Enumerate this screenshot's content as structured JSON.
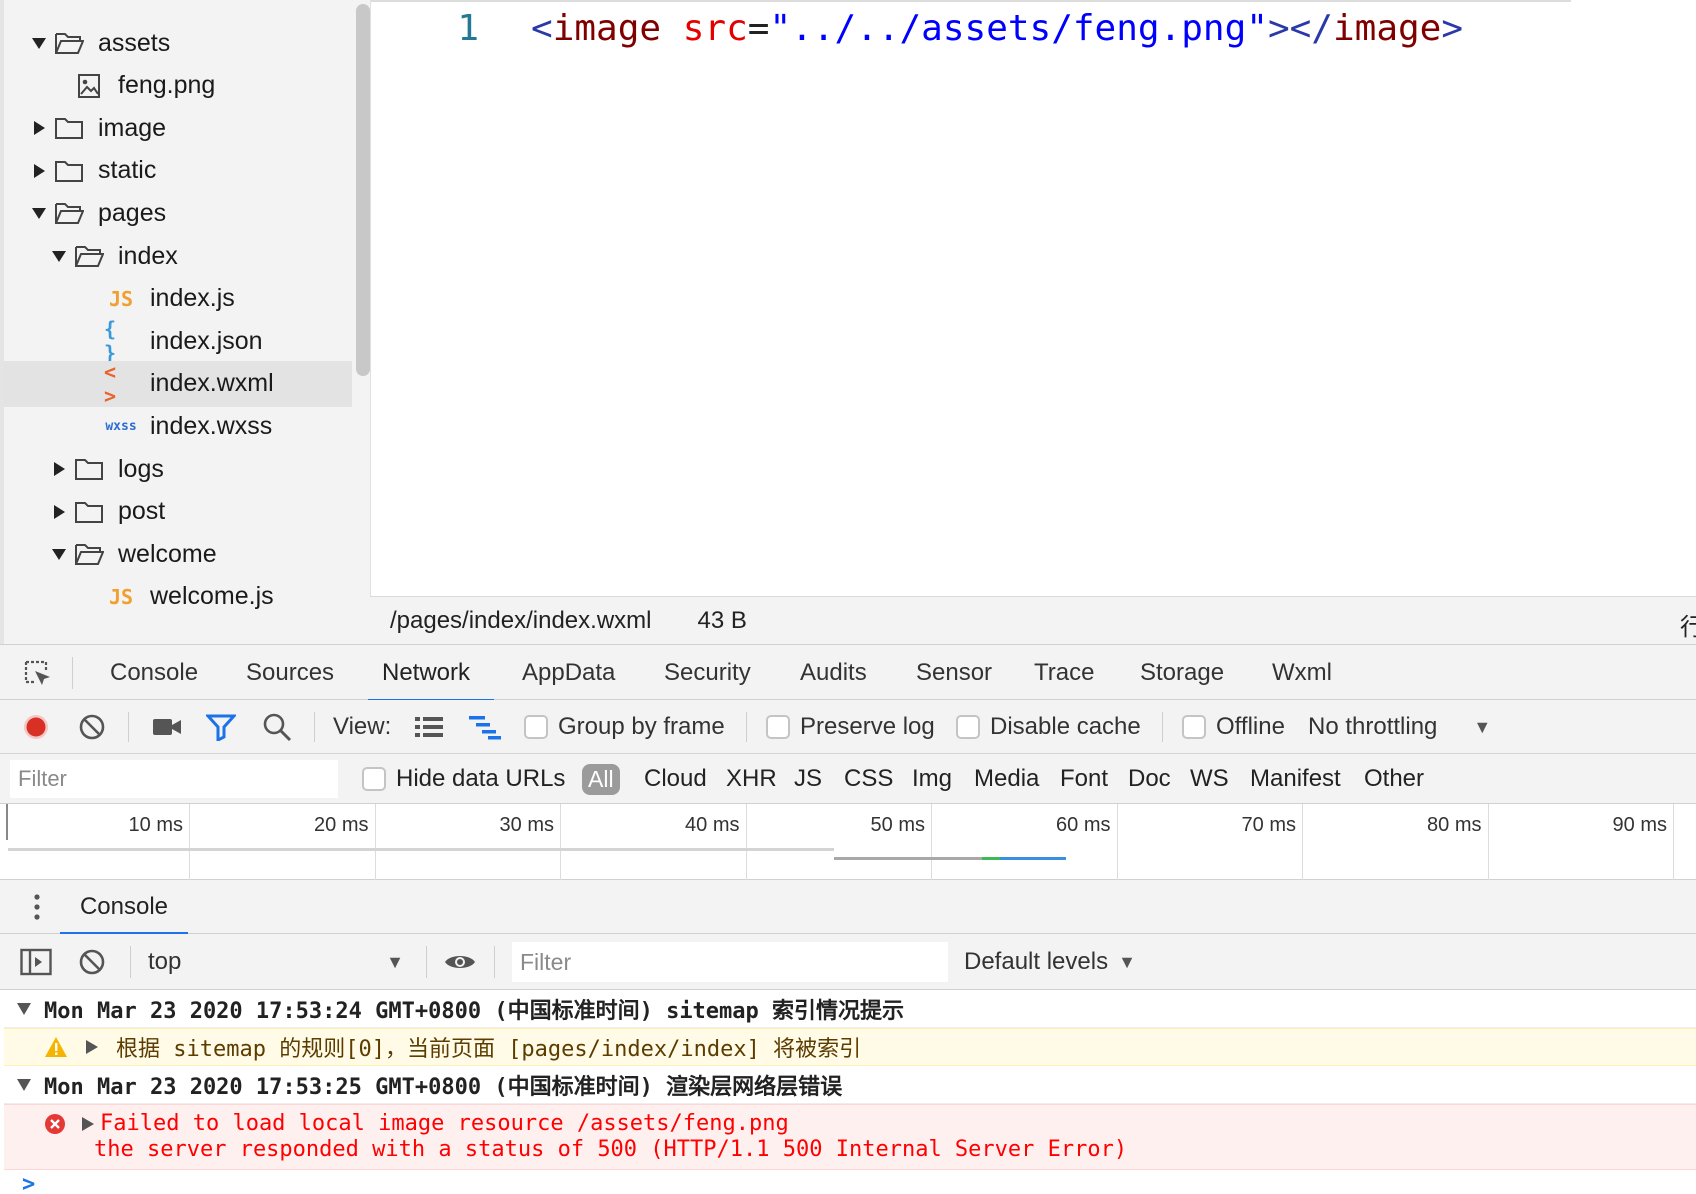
{
  "file_tree": {
    "items": [
      {
        "label": "assets",
        "type": "folder",
        "expanded": true,
        "depth": 0
      },
      {
        "label": "feng.png",
        "type": "image",
        "depth": 1
      },
      {
        "label": "image",
        "type": "folder",
        "expanded": false,
        "depth": 0
      },
      {
        "label": "static",
        "type": "folder",
        "expanded": false,
        "depth": 0
      },
      {
        "label": "pages",
        "type": "folder",
        "expanded": true,
        "depth": 0
      },
      {
        "label": "index",
        "type": "folder",
        "expanded": true,
        "depth": 1
      },
      {
        "label": "index.js",
        "type": "js",
        "icon_text": "JS",
        "depth": 2
      },
      {
        "label": "index.json",
        "type": "json",
        "icon_text": "{ }",
        "depth": 2
      },
      {
        "label": "index.wxml",
        "type": "wxml",
        "icon_text": "< >",
        "depth": 2,
        "selected": true
      },
      {
        "label": "index.wxss",
        "type": "wxss",
        "icon_text": "wxss",
        "depth": 2
      },
      {
        "label": "logs",
        "type": "folder",
        "expanded": false,
        "depth": 1
      },
      {
        "label": "post",
        "type": "folder",
        "expanded": false,
        "depth": 1
      },
      {
        "label": "welcome",
        "type": "folder",
        "expanded": true,
        "depth": 1
      },
      {
        "label": "welcome.js",
        "type": "js",
        "icon_text": "JS",
        "depth": 2
      }
    ]
  },
  "editor": {
    "line_number": "1",
    "code": {
      "open_bracket": "<",
      "tag": "image",
      "attr": " src",
      "eq": "=",
      "value": "\"../../assets/feng.png\"",
      "close_open": "></",
      "close_tag": "image",
      "close_bracket": ">"
    }
  },
  "status_bar": {
    "path": "/pages/index/index.wxml",
    "size": "43 B",
    "edge_text": "行"
  },
  "devtools": {
    "tabs": [
      "Console",
      "Sources",
      "Network",
      "AppData",
      "Security",
      "Audits",
      "Sensor",
      "Trace",
      "Storage",
      "Wxml"
    ],
    "active_tab": "Network"
  },
  "network_toolbar": {
    "view_label": "View:",
    "group_by_frame": "Group by frame",
    "preserve_log": "Preserve log",
    "disable_cache": "Disable cache",
    "offline": "Offline",
    "throttling": "No throttling"
  },
  "network_filter": {
    "placeholder": "Filter",
    "hide_data_urls": "Hide data URLs",
    "types": [
      "All",
      "Cloud",
      "XHR",
      "JS",
      "CSS",
      "Img",
      "Media",
      "Font",
      "Doc",
      "WS",
      "Manifest",
      "Other"
    ],
    "active_type": "All"
  },
  "timeline": {
    "ticks": [
      "10 ms",
      "20 ms",
      "30 ms",
      "40 ms",
      "50 ms",
      "60 ms",
      "70 ms",
      "80 ms",
      "90 ms"
    ]
  },
  "console_drawer": {
    "tab": "Console",
    "context": "top",
    "filter_placeholder": "Filter",
    "levels": "Default levels"
  },
  "console_messages": {
    "group1": "Mon Mar 23 2020 17:53:24 GMT+0800 (中国标准时间) sitemap 索引情况提示",
    "warn": "根据 sitemap 的规则[0]，当前页面 [pages/index/index] 将被索引",
    "group2": "Mon Mar 23 2020 17:53:25 GMT+0800 (中国标准时间) 渲染层网络层错误",
    "error_line1": "Failed to load local image resource /assets/feng.png",
    "error_line2": "the server responded with a status of 500 (HTTP/1.1 500 Internal Server Error)",
    "prompt": ">"
  },
  "colors": {
    "accent": "#1a73e8",
    "record": "#d93025",
    "js_icon": "#f0a030",
    "json_icon": "#3a9ad9",
    "wxml_icon": "#e8632b",
    "wxss_icon": "#2c6fd1",
    "error": "#ff0000",
    "warning_bg": "#fffbe6"
  }
}
